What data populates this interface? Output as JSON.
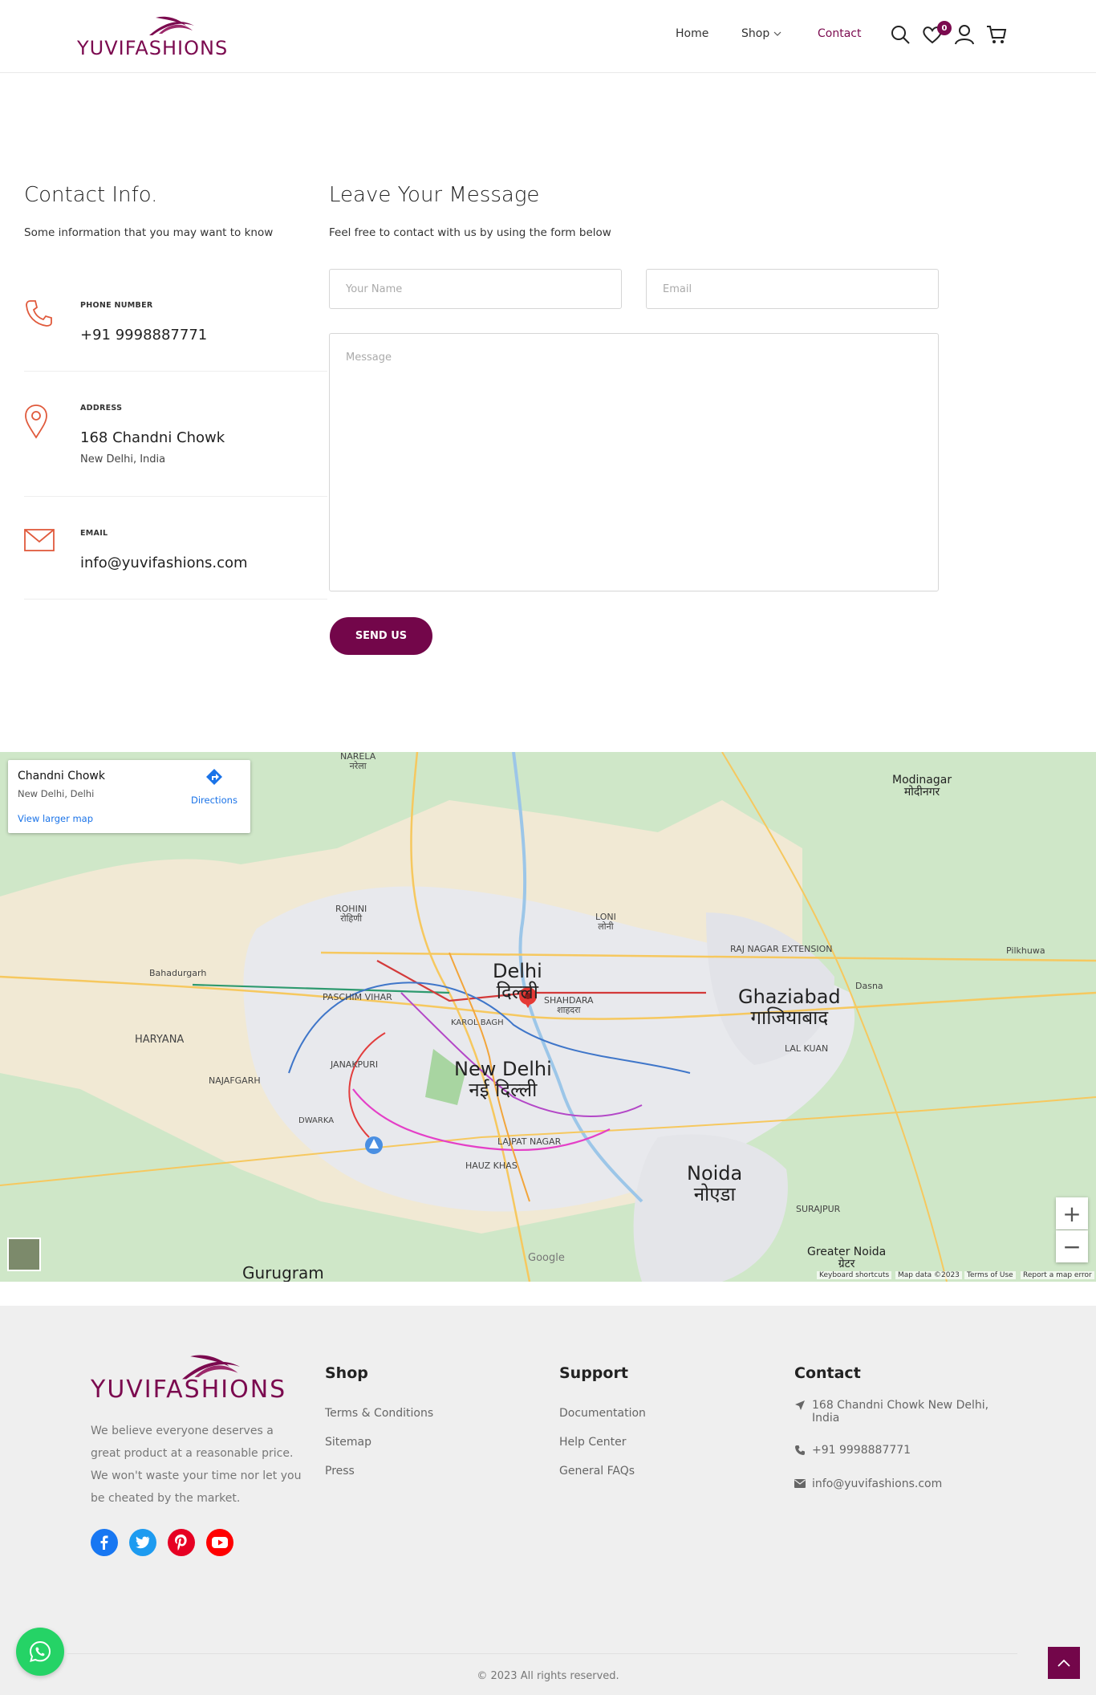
{
  "brand": {
    "name": "YUVIFASHIONS",
    "color": "#7b0a4f"
  },
  "nav": {
    "home": "Home",
    "shop": "Shop",
    "contact": "Contact",
    "wishlist_count": "0"
  },
  "contact_info": {
    "title": "Contact Info.",
    "subtitle": "Some information that you may want to know",
    "phone": {
      "label": "PHONE NUMBER",
      "value": "+91 9998887771"
    },
    "address": {
      "label": "ADDRESS",
      "value": "168 Chandni Chowk",
      "extra": "New Delhi, India"
    },
    "email": {
      "label": "EMAIL",
      "value": "info@yuvifashions.com"
    }
  },
  "form": {
    "title": "Leave Your Message",
    "subtitle": "Feel free to contact with us by using the form below",
    "name_placeholder": "Your Name",
    "email_placeholder": "Email",
    "message_placeholder": "Message",
    "submit": "SEND US"
  },
  "map": {
    "place": "Chandni Chowk",
    "address": "New Delhi, Delhi",
    "larger": "View larger map",
    "directions": "Directions",
    "keyboard": "Keyboard shortcuts",
    "mapdata": "Map data ©2023",
    "terms": "Terms of Use",
    "report": "Report a map error",
    "labels": {
      "delhi": "Delhi",
      "delhi_hi": "दिल्ली",
      "newdelhi": "New Delhi",
      "newdelhi_hi": "नई दिल्ली",
      "ghaziabad": "Ghaziabad",
      "ghaziabad_hi": "गाजियाबाद",
      "noida": "Noida",
      "noida_hi": "नोएडा",
      "gurugram": "Gurugram",
      "greater_noida": "Greater Noida",
      "greater_noida_hi": "ग्रेटर",
      "rohini": "ROHINI",
      "rohini_hi": "रोहिणी",
      "narela": "NARELA",
      "narela_hi": "नरेला",
      "modinagar": "Modinagar",
      "modinagar_hi": "मोदीनगर",
      "loni": "LONI",
      "loni_hi": "लोनी",
      "shahdara": "SHAHDARA",
      "shahdara_hi": "शाहदरा",
      "paschim_vihar": "PASCHIM VIHAR",
      "janakpuri": "JANAKPURI",
      "najafgarh": "NAJAFGARH",
      "dwarka": "DWARKA",
      "karol_bagh": "KAROL BAGH",
      "lajpat_nagar": "LAJPAT NAGAR",
      "hauz_khas": "HAUZ KHAS",
      "raj_nagar": "RAJ NAGAR EXTENSION",
      "lal_kuan": "LAL KUAN",
      "surajpur": "SURAJPUR",
      "haryana": "HARYANA",
      "bahadurgarh": "Bahadurgarh",
      "dasna": "Dasna",
      "pilkhuwa": "Pilkhuwa",
      "google": "Google"
    }
  },
  "footer": {
    "about": "We believe everyone deserves a great product at a reasonable price. We won't waste your time nor let you be cheated by the market.",
    "shop_title": "Shop",
    "shop_links": [
      "Terms & Conditions",
      "Sitemap",
      "Press"
    ],
    "support_title": "Support",
    "support_links": [
      "Documentation",
      "Help Center",
      "General FAQs"
    ],
    "contact_title": "Contact",
    "contact_address": "168 Chandni Chowk New Delhi, India",
    "contact_phone": "+91 9998887771",
    "contact_email": "info@yuvifashions.com",
    "copyright": "© 2023 All rights reserved."
  }
}
